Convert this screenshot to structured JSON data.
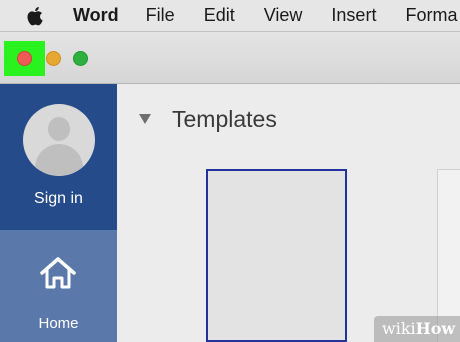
{
  "menubar": {
    "apple_icon": "apple-logo-icon",
    "items": [
      "Word",
      "File",
      "Edit",
      "View",
      "Insert",
      "Forma"
    ]
  },
  "titlebar": {
    "traffic_lights": {
      "close_color": "#ee5b57",
      "minimize_color": "#e7a733",
      "zoom_color": "#2faf3d",
      "highlight_color": "#2af21f"
    }
  },
  "sidebar": {
    "sign_in_label": "Sign in",
    "home_label": "Home",
    "background_color": "#2b5598"
  },
  "main": {
    "section_title": "Templates"
  },
  "watermark": {
    "prefix": "wiki",
    "suffix": "How"
  }
}
